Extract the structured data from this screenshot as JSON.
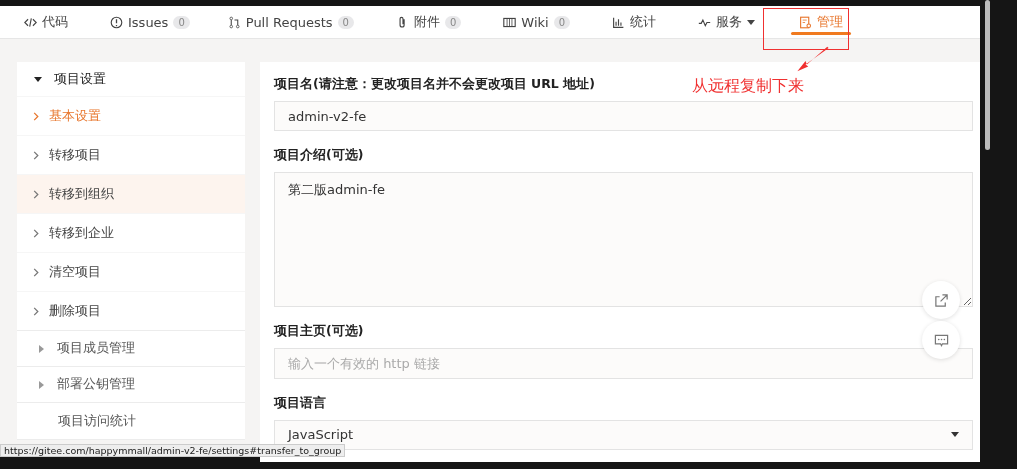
{
  "tabs": [
    {
      "label": "代码",
      "selected": false
    },
    {
      "label": "Issues",
      "count": "0",
      "selected": false
    },
    {
      "label": "Pull Requests",
      "count": "0",
      "selected": false
    },
    {
      "label": "附件",
      "count": "0",
      "selected": false
    },
    {
      "label": "Wiki",
      "count": "0",
      "selected": false
    },
    {
      "label": "统计",
      "selected": false
    },
    {
      "label": "服务",
      "dropdown": true,
      "selected": false
    },
    {
      "label": "管理",
      "selected": true
    }
  ],
  "sidebar": [
    {
      "label": "项目设置",
      "kind": "group",
      "expanded": true,
      "children": [
        {
          "label": "基本设置",
          "selected": true,
          "hovered": false
        },
        {
          "label": "转移项目",
          "selected": false,
          "hovered": false
        },
        {
          "label": "转移到组织",
          "selected": false,
          "hovered": true
        },
        {
          "label": "转移到企业",
          "selected": false,
          "hovered": false
        },
        {
          "label": "清空项目",
          "selected": false,
          "hovered": false
        },
        {
          "label": "删除项目",
          "selected": false,
          "hovered": false
        }
      ]
    },
    {
      "label": "项目成员管理",
      "kind": "group",
      "expanded": false
    },
    {
      "label": "部署公钥管理",
      "kind": "group",
      "expanded": false
    },
    {
      "label": "项目访问统计",
      "kind": "link"
    }
  ],
  "form": [
    {
      "label": "项目名(请注意：更改项目名并不会更改项目 URL 地址)",
      "kind": "text",
      "value": "admin-v2-fe"
    },
    {
      "label": "项目介绍(可选)",
      "kind": "textarea",
      "value": "第二版admin-fe"
    },
    {
      "label": "项目主页(可选)",
      "kind": "text",
      "placeholder": "输入一个有效的 http 链接"
    },
    {
      "label": "项目语言",
      "kind": "select",
      "value": "JavaScript"
    }
  ],
  "annotation": {
    "text": "从远程复制下来"
  },
  "status_bar": {
    "url": "https://gitee.com/happymmall/admin-v2-fe/settings#transfer_to_group"
  }
}
